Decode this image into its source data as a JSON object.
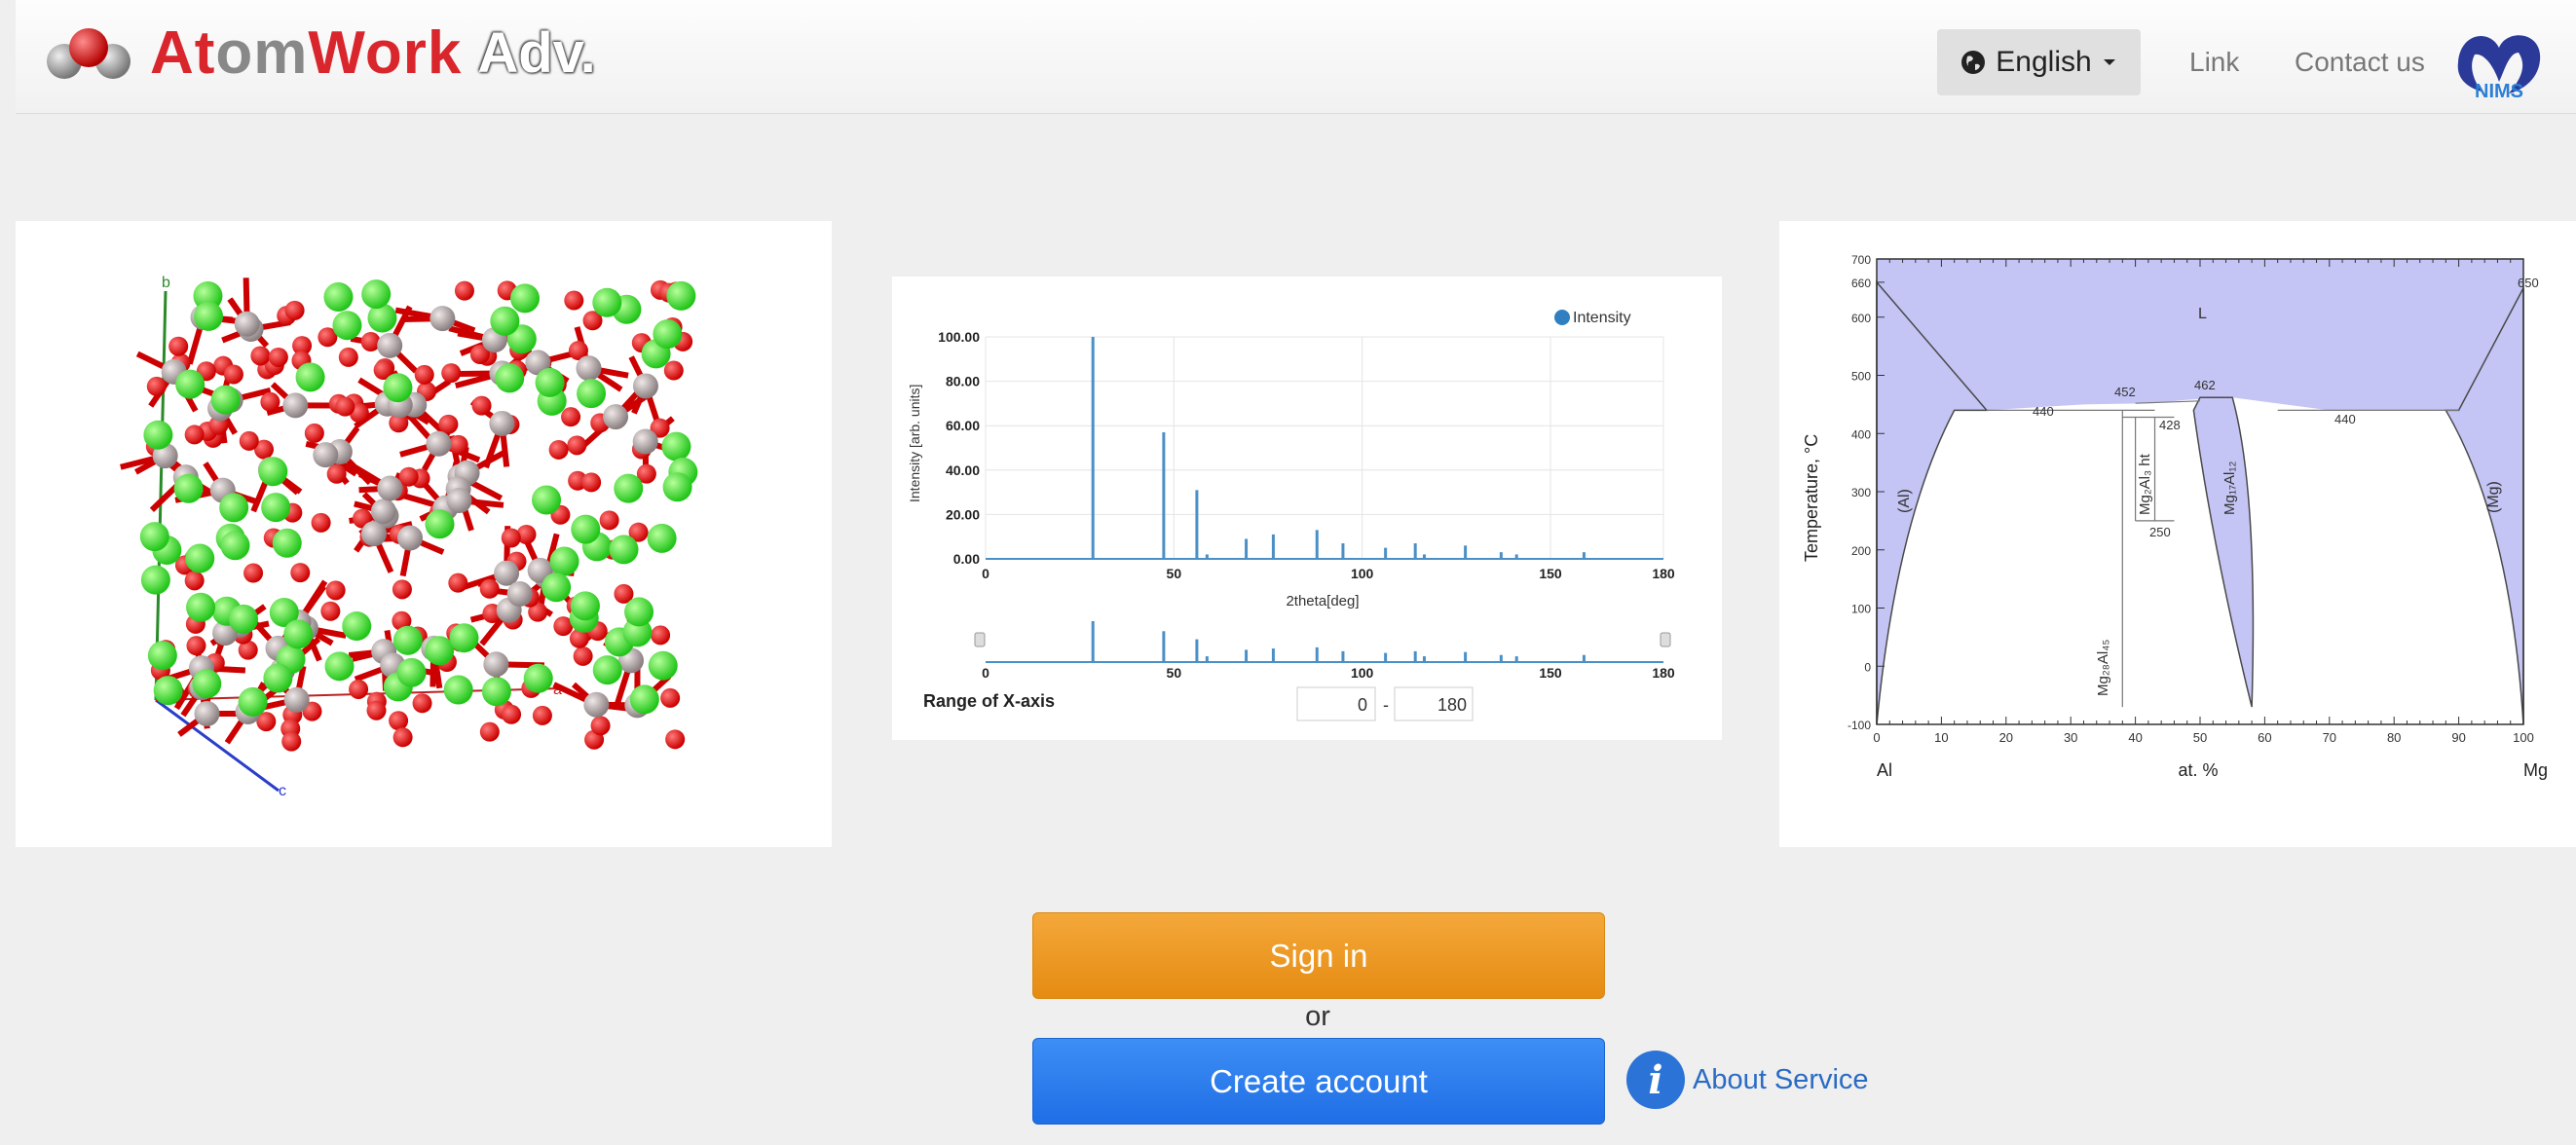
{
  "header": {
    "logo_text": {
      "part1": "At",
      "part2": "om",
      "part3": "Work"
    },
    "logo_adv": "Adv.",
    "language_label": "English",
    "link_label": "Link",
    "contact_label": "Contact us",
    "nims_label": "NIMS"
  },
  "carousel": {
    "structure": {
      "axis_a": "a",
      "axis_b": "b",
      "axis_c": "c"
    },
    "xrd": {
      "legend": "Intensity",
      "ylabel": "Intensity [arb. units]",
      "xlabel": "2theta[deg]",
      "range_label": "Range of X-axis",
      "range_min": "0",
      "range_max": "180",
      "range_sep": "-"
    },
    "phase": {
      "ylabel": "Temperature, °C",
      "xlabel": "at. %",
      "left_element": "Al",
      "right_element": "Mg",
      "labels": {
        "L": "L",
        "al_phase": "(Al)",
        "mg_phase": "(Mg)",
        "t650": "650",
        "t452": "452",
        "t462": "462",
        "t440a": "440",
        "t440b": "440",
        "t428": "428",
        "t250": "250",
        "mg17al12": "Mg₁₇Al₁₂",
        "mg2al3_ht": "Mg₂Al₃ ht",
        "mg28al45": "Mg₂₈Al₄₅"
      }
    }
  },
  "buttons": {
    "signin": "Sign in",
    "or": "or",
    "create": "Create account",
    "about": "About Service",
    "about_icon": "i"
  },
  "chart_data": [
    {
      "type": "bar",
      "title": "",
      "xlabel": "2theta[deg]",
      "ylabel": "Intensity [arb. units]",
      "xlim": [
        0,
        180
      ],
      "ylim": [
        0,
        100
      ],
      "x_ticks": [
        0,
        50,
        100,
        150,
        180
      ],
      "y_ticks": [
        "0.00",
        "20.00",
        "40.00",
        "60.00",
        "80.00",
        "100.00"
      ],
      "legend": "top-right",
      "series": [
        {
          "name": "Intensity",
          "x": [
            28.5,
            47.3,
            56.1,
            58.8,
            69.2,
            76.4,
            88.0,
            94.9,
            106.2,
            114.1,
            116.5,
            127.4,
            136.9,
            141.0,
            158.9
          ],
          "y": [
            100,
            57,
            31,
            2,
            9,
            11,
            13,
            7,
            5,
            7,
            2,
            6,
            3,
            2,
            3
          ]
        }
      ],
      "color": "#4a8fc6"
    },
    {
      "type": "area",
      "title": "",
      "xlabel": "at. %",
      "ylabel": "Temperature, °C",
      "xlim": [
        0,
        100
      ],
      "ylim": [
        -100,
        700
      ],
      "x_ticks": [
        0,
        10,
        20,
        30,
        40,
        50,
        60,
        70,
        80,
        90,
        100
      ],
      "y_ticks": [
        -100,
        0,
        100,
        200,
        300,
        400,
        500,
        600,
        660,
        700
      ],
      "fill_color": "#c4c4f5",
      "line_color": "#4a4a4a"
    }
  ]
}
